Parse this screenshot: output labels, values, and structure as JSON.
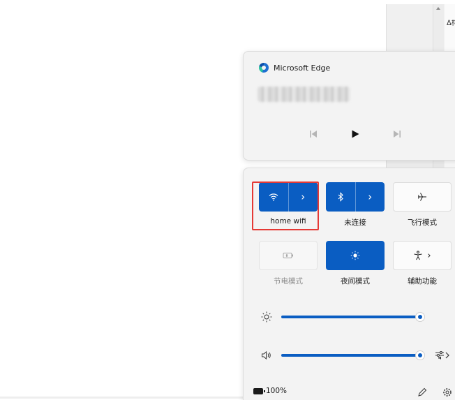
{
  "background": {
    "side_text": "ᐃ样"
  },
  "media": {
    "app_name": "Microsoft Edge",
    "icons": {
      "app": "edge-icon",
      "previous": "previous-track-icon",
      "play": "play-icon",
      "next": "next-track-icon"
    }
  },
  "quick_settings": {
    "tiles": [
      {
        "id": "wifi",
        "label": "home wifi",
        "state": "on",
        "icon": "wifi-icon",
        "has_chevron": true
      },
      {
        "id": "bluetooth",
        "label": "未连接",
        "state": "on",
        "icon": "bluetooth-icon",
        "has_chevron": true
      },
      {
        "id": "airplane",
        "label": "飞行模式",
        "state": "off",
        "icon": "airplane-icon",
        "has_chevron": false
      },
      {
        "id": "battery-saver",
        "label": "节电模式",
        "state": "disabled",
        "icon": "battery-saver-icon",
        "has_chevron": false
      },
      {
        "id": "night-light",
        "label": "夜间模式",
        "state": "on",
        "icon": "night-light-icon",
        "has_chevron": false
      },
      {
        "id": "accessibility",
        "label": "辅助功能",
        "state": "off",
        "icon": "accessibility-icon",
        "has_chevron": true
      }
    ],
    "brightness": {
      "icon": "brightness-icon",
      "value": 1.0
    },
    "volume": {
      "icon": "speaker-icon",
      "value": 1.0,
      "output_icon": "audio-output-icon"
    },
    "battery": {
      "percent": "100%",
      "icon": "battery-icon"
    },
    "footer_icons": {
      "edit": "pencil-icon",
      "settings": "gear-icon"
    },
    "colors": {
      "accent": "#0a5dc2",
      "panel": "#f3f3f3",
      "highlight": "#e53935"
    }
  }
}
